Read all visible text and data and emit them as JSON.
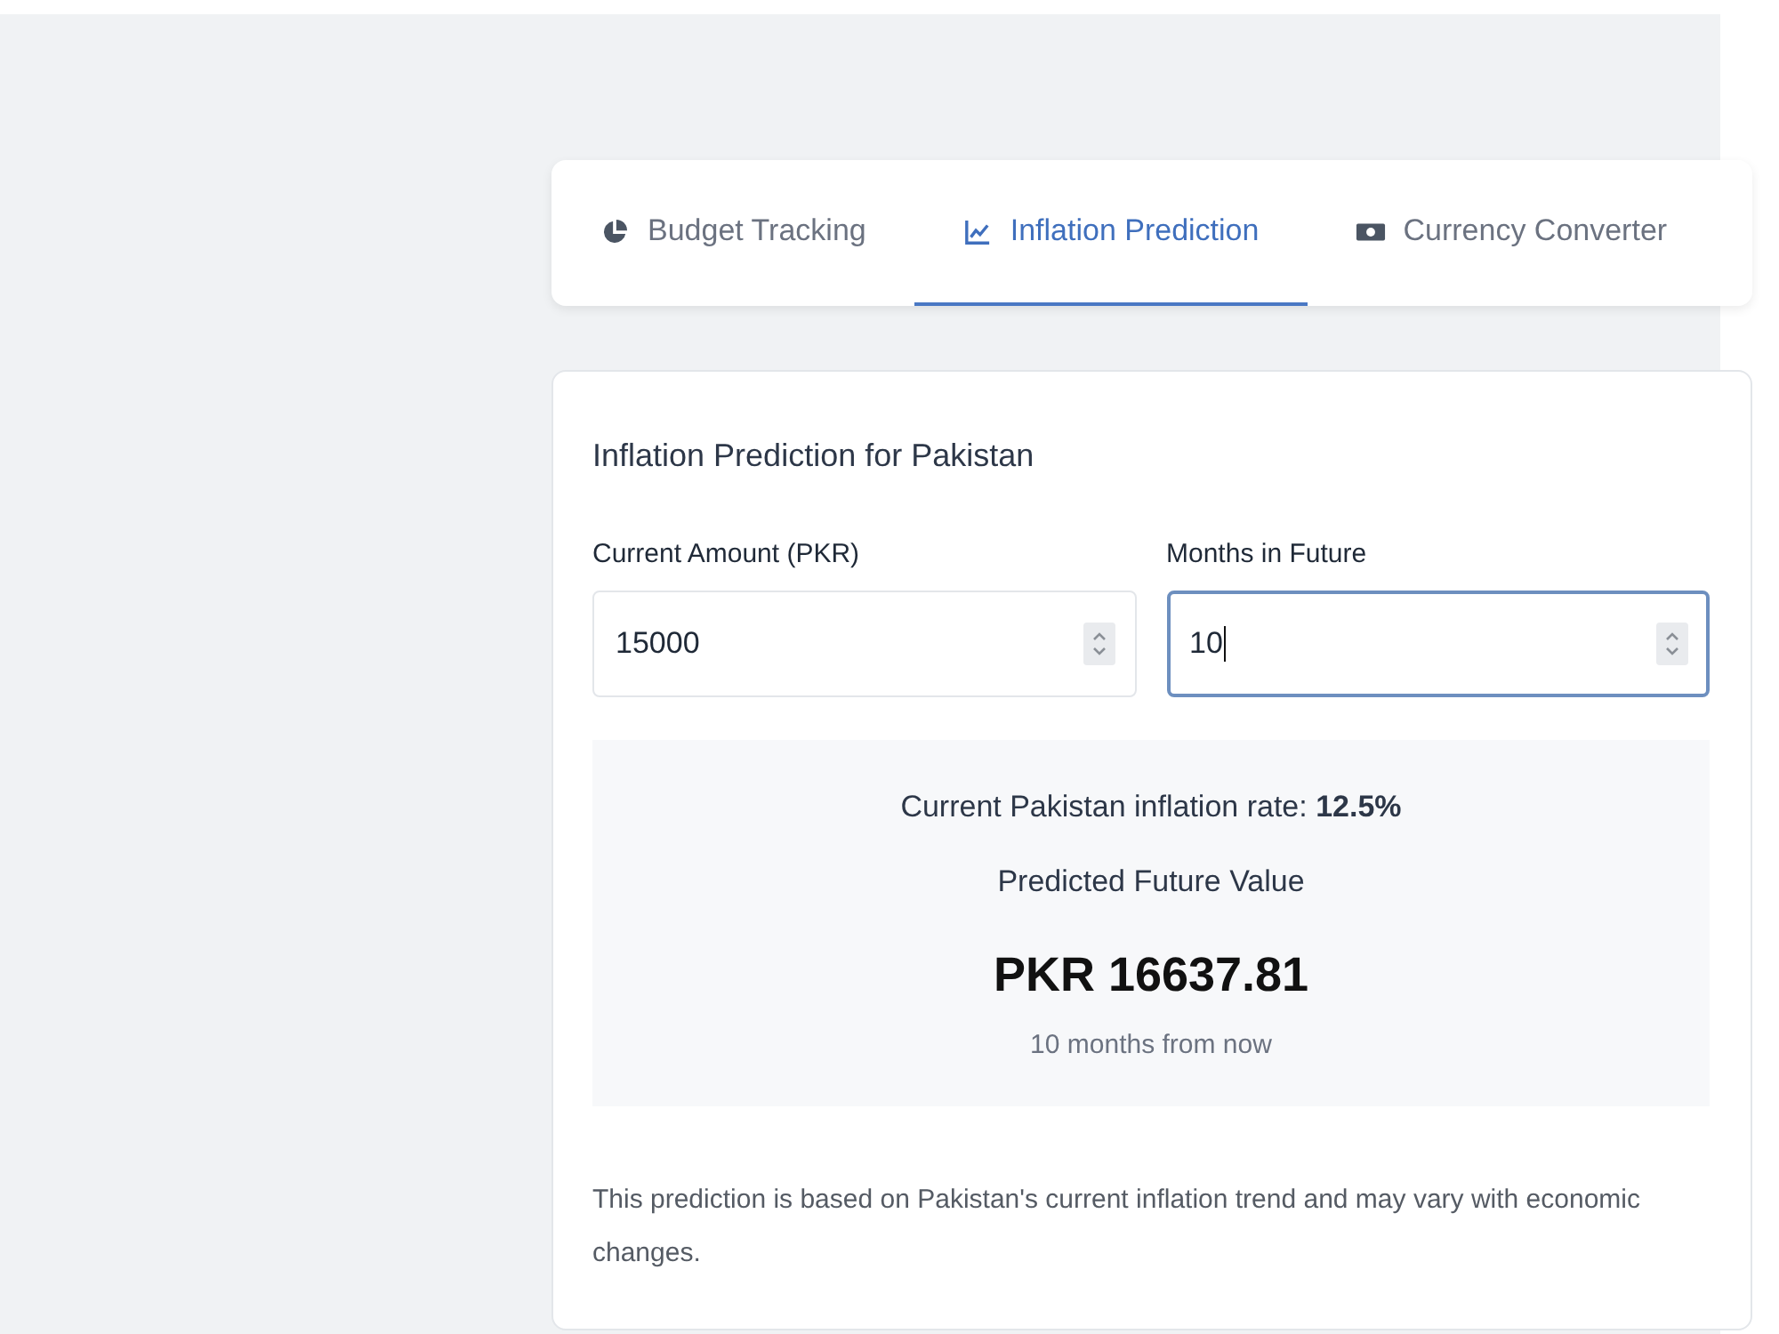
{
  "tabs": [
    {
      "label": "Budget Tracking",
      "selected": false
    },
    {
      "label": "Inflation Prediction",
      "selected": true
    },
    {
      "label": "Currency Converter",
      "selected": false
    }
  ],
  "form": {
    "title": "Inflation Prediction for Pakistan",
    "fields": [
      {
        "label": "Current Amount (PKR)",
        "value": "15000",
        "focused": false
      },
      {
        "label": "Months in Future",
        "value": "10",
        "focused": true
      }
    ],
    "result": {
      "rate_text": "Current Pakistan inflation rate: **12.5%**",
      "heading": "Predicted Future Value",
      "amount": "PKR 16637.81",
      "period": "10 months from now"
    },
    "note": "This prediction is based on Pakistan's current inflation trend and may vary with economic changes."
  }
}
